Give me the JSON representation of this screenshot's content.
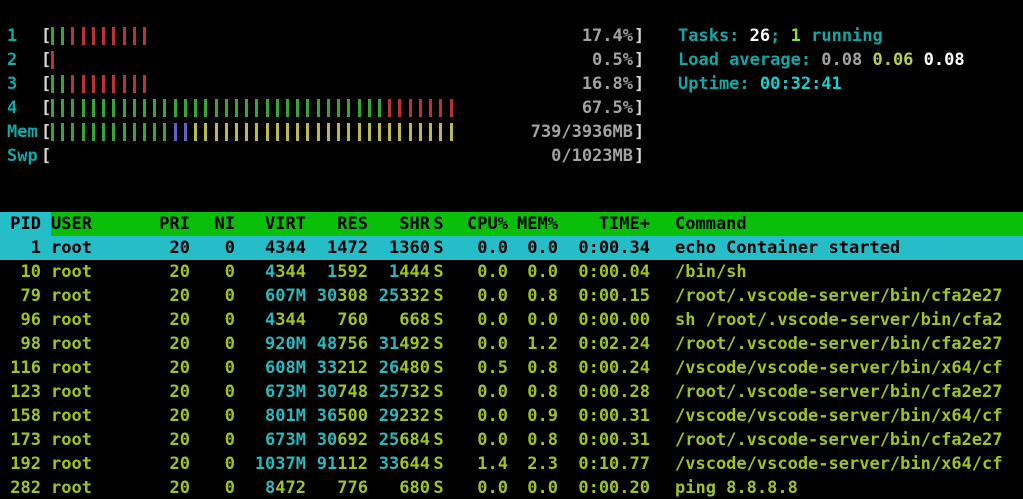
{
  "meters": [
    {
      "label": "1",
      "value": "17.4%",
      "segments": [
        [
          "green",
          2
        ],
        [
          "red",
          8
        ]
      ]
    },
    {
      "label": "2",
      "value": "0.5%",
      "segments": [
        [
          "red",
          1
        ]
      ]
    },
    {
      "label": "3",
      "value": "16.8%",
      "segments": [
        [
          "green",
          2
        ],
        [
          "red",
          8
        ]
      ]
    },
    {
      "label": "4",
      "value": "67.5%",
      "segments": [
        [
          "green",
          33
        ],
        [
          "red",
          7
        ]
      ]
    },
    {
      "label": "Mem",
      "value": "739/3936MB",
      "segments": [
        [
          "green",
          12
        ],
        [
          "blue",
          2
        ],
        [
          "yellow",
          26
        ]
      ]
    },
    {
      "label": "Swp",
      "value": "0/1023MB",
      "segments": []
    }
  ],
  "info": {
    "tasks": {
      "label": "Tasks: ",
      "count": "26",
      "sep": "; ",
      "running_count": "1",
      "running_label": " running"
    },
    "load": {
      "label": "Load average: ",
      "one": "0.08",
      "five": "0.06",
      "fifteen": "0.08"
    },
    "uptime": {
      "label": "Uptime: ",
      "value": "00:32:41"
    }
  },
  "colors": {
    "header_bg": "#0abf0a",
    "selected_bg": "#25bdc8",
    "text_green": "#9fc325",
    "text_cyan": "#2cb8bc",
    "label_cyan": "#14a7a7",
    "gray": "#a2a2a2",
    "bar_green": "#37a437",
    "bar_red": "#bb3434",
    "bar_blue": "#6161c4",
    "bar_yellow": "#b9b94e"
  },
  "table": {
    "columns": [
      "PID",
      "USER",
      "PRI",
      "NI",
      "VIRT",
      "RES",
      "SHR",
      "S",
      "CPU%",
      "MEM%",
      "TIME+",
      "Command"
    ],
    "sort_column": "PID",
    "rows": [
      {
        "selected": true,
        "pid": "1",
        "user": "root",
        "pri": "20",
        "ni": "0",
        "virt": [
          "4",
          "344"
        ],
        "res": [
          "1",
          "472"
        ],
        "shr": [
          "1",
          "360"
        ],
        "s": "S",
        "cpu": "0.0",
        "mem": "0.0",
        "time": "0:00.34",
        "cmd": "echo Container started"
      },
      {
        "selected": false,
        "pid": "10",
        "user": "root",
        "pri": "20",
        "ni": "0",
        "virt": [
          "4",
          "344"
        ],
        "res": [
          "1",
          "592"
        ],
        "shr": [
          "1",
          "444"
        ],
        "s": "S",
        "cpu": "0.0",
        "mem": "0.0",
        "time": "0:00.04",
        "cmd": "/bin/sh"
      },
      {
        "selected": false,
        "pid": "79",
        "user": "root",
        "pri": "20",
        "ni": "0",
        "virt": [
          "607M",
          ""
        ],
        "res": [
          "30",
          "308"
        ],
        "shr": [
          "25",
          "332"
        ],
        "s": "S",
        "cpu": "0.0",
        "mem": "0.8",
        "time": "0:00.15",
        "cmd": "/root/.vscode-server/bin/cfa2e27"
      },
      {
        "selected": false,
        "pid": "96",
        "user": "root",
        "pri": "20",
        "ni": "0",
        "virt": [
          "4",
          "344"
        ],
        "res": [
          "",
          "760"
        ],
        "shr": [
          "",
          "668"
        ],
        "s": "S",
        "cpu": "0.0",
        "mem": "0.0",
        "time": "0:00.00",
        "cmd": "sh /root/.vscode-server/bin/cfa2"
      },
      {
        "selected": false,
        "pid": "98",
        "user": "root",
        "pri": "20",
        "ni": "0",
        "virt": [
          "920M",
          ""
        ],
        "res": [
          "48",
          "756"
        ],
        "shr": [
          "31",
          "492"
        ],
        "s": "S",
        "cpu": "0.0",
        "mem": "1.2",
        "time": "0:02.24",
        "cmd": "/root/.vscode-server/bin/cfa2e27"
      },
      {
        "selected": false,
        "pid": "116",
        "user": "root",
        "pri": "20",
        "ni": "0",
        "virt": [
          "608M",
          ""
        ],
        "res": [
          "33",
          "212"
        ],
        "shr": [
          "26",
          "480"
        ],
        "s": "S",
        "cpu": "0.5",
        "mem": "0.8",
        "time": "0:00.24",
        "cmd": "/vscode/vscode-server/bin/x64/cf"
      },
      {
        "selected": false,
        "pid": "123",
        "user": "root",
        "pri": "20",
        "ni": "0",
        "virt": [
          "673M",
          ""
        ],
        "res": [
          "30",
          "748"
        ],
        "shr": [
          "25",
          "732"
        ],
        "s": "S",
        "cpu": "0.0",
        "mem": "0.8",
        "time": "0:00.28",
        "cmd": "/root/.vscode-server/bin/cfa2e27"
      },
      {
        "selected": false,
        "pid": "158",
        "user": "root",
        "pri": "20",
        "ni": "0",
        "virt": [
          "801M",
          ""
        ],
        "res": [
          "36",
          "500"
        ],
        "shr": [
          "29",
          "232"
        ],
        "s": "S",
        "cpu": "0.0",
        "mem": "0.9",
        "time": "0:00.31",
        "cmd": "/vscode/vscode-server/bin/x64/cf"
      },
      {
        "selected": false,
        "pid": "173",
        "user": "root",
        "pri": "20",
        "ni": "0",
        "virt": [
          "673M",
          ""
        ],
        "res": [
          "30",
          "692"
        ],
        "shr": [
          "25",
          "684"
        ],
        "s": "S",
        "cpu": "0.0",
        "mem": "0.8",
        "time": "0:00.31",
        "cmd": "/root/.vscode-server/bin/cfa2e27"
      },
      {
        "selected": false,
        "pid": "192",
        "user": "root",
        "pri": "20",
        "ni": "0",
        "virt": [
          "1037M",
          ""
        ],
        "res": [
          "91",
          "112"
        ],
        "shr": [
          "33",
          "644"
        ],
        "s": "S",
        "cpu": "1.4",
        "mem": "2.3",
        "time": "0:10.77",
        "cmd": "/vscode/vscode-server/bin/x64/cf"
      },
      {
        "selected": false,
        "pid": "282",
        "user": "root",
        "pri": "20",
        "ni": "0",
        "virt": [
          "8",
          "472"
        ],
        "res": [
          "",
          "776"
        ],
        "shr": [
          "",
          "680"
        ],
        "s": "S",
        "cpu": "0.0",
        "mem": "0.0",
        "time": "0:00.20",
        "cmd": "ping 8.8.8.8"
      }
    ]
  }
}
